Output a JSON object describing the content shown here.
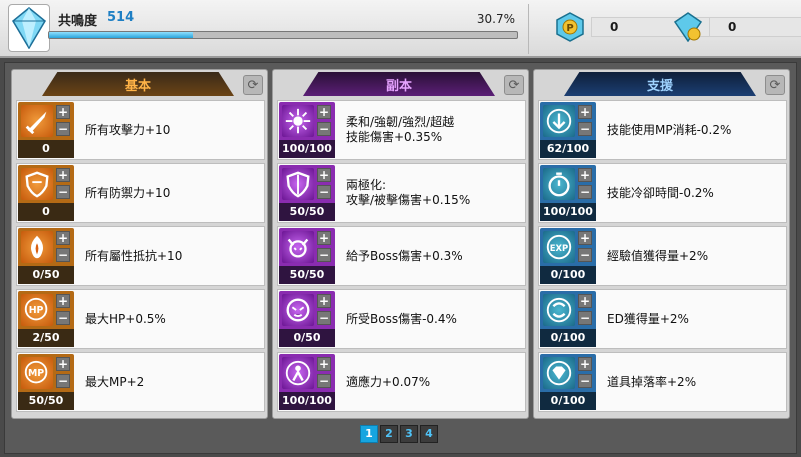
{
  "resonance": {
    "label": "共鳴度",
    "value": "514",
    "percent": "30.7%",
    "progress_fraction": 0.307
  },
  "currencies": [
    {
      "icon": "p-point-coin-icon",
      "value": "0"
    },
    {
      "icon": "crystal-coin-icon",
      "value": "0"
    }
  ],
  "columns": [
    {
      "title": "基本",
      "theme": "orange",
      "items": [
        {
          "icon": "sword-icon",
          "level": "0",
          "desc": "所有攻擊力+10"
        },
        {
          "icon": "shield-icon",
          "level": "0",
          "desc": "所有防禦力+10"
        },
        {
          "icon": "flame-shield-icon",
          "level": "0/50",
          "desc": "所有屬性抵抗+10"
        },
        {
          "icon": "hp-plus-icon",
          "level": "2/50",
          "desc": "最大HP+0.5%"
        },
        {
          "icon": "mp-plus-icon",
          "level": "50/50",
          "desc": "最大MP+2"
        }
      ]
    },
    {
      "title": "副本",
      "theme": "purple",
      "items": [
        {
          "icon": "burst-icon",
          "level": "100/100",
          "desc": "柔和/強韌/強烈/超越\n技能傷害+0.35%"
        },
        {
          "icon": "split-shield-icon",
          "level": "50/50",
          "desc": "兩極化:\n攻擊/被擊傷害+0.15%"
        },
        {
          "icon": "boss-demon-icon",
          "level": "50/50",
          "desc": "給予Boss傷害+0.3%"
        },
        {
          "icon": "boss-shield-icon",
          "level": "0/50",
          "desc": "所受Boss傷害-0.4%"
        },
        {
          "icon": "adapt-person-icon",
          "level": "100/100",
          "desc": "適應力+0.07%"
        }
      ]
    },
    {
      "title": "支援",
      "theme": "blue",
      "items": [
        {
          "icon": "mp-down-icon",
          "level": "62/100",
          "desc": "技能使用MP消耗-0.2%"
        },
        {
          "icon": "stopwatch-icon",
          "level": "100/100",
          "desc": "技能冷卻時間-0.2%"
        },
        {
          "icon": "exp-up-icon",
          "level": "0/100",
          "desc": "經驗值獲得量+2%"
        },
        {
          "icon": "ed-coin-icon",
          "level": "0/100",
          "desc": "ED獲得量+2%"
        },
        {
          "icon": "diamond-drop-icon",
          "level": "0/100",
          "desc": "道具掉落率+2%"
        }
      ]
    }
  ],
  "pagination": {
    "pages": [
      "1",
      "2",
      "3",
      "4"
    ],
    "current": "1"
  }
}
